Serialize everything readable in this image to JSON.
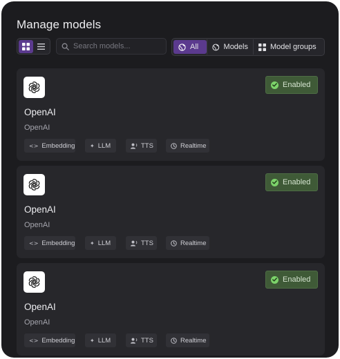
{
  "header": {
    "title": "Manage models"
  },
  "view_toggle": {
    "grid_icon": "grid-icon",
    "list_icon": "list-icon",
    "active": "grid"
  },
  "search": {
    "placeholder": "Search models...",
    "value": ""
  },
  "filters": [
    {
      "label": "All",
      "icon": "globe-icon",
      "active": true
    },
    {
      "label": "Models",
      "icon": "globe-icon",
      "active": false
    },
    {
      "label": "Model groups",
      "icon": "grid-icon",
      "active": false
    }
  ],
  "colors": {
    "background": "#1c1c1f",
    "card": "#27272b",
    "accent": "#5b3a8e",
    "enabled_badge": "#3f5a37",
    "enabled_check": "#7cd36a"
  },
  "cards": [
    {
      "name": "OpenAI",
      "provider": "OpenAI",
      "status": "Enabled",
      "tags": [
        {
          "label": "Embedding",
          "icon": "code-icon"
        },
        {
          "label": "LLM",
          "icon": "sparkle-icon"
        },
        {
          "label": "TTS",
          "icon": "voice-icon"
        },
        {
          "label": "Realtime",
          "icon": "clock-icon"
        }
      ]
    },
    {
      "name": "OpenAI",
      "provider": "OpenAI",
      "status": "Enabled",
      "tags": [
        {
          "label": "Embedding",
          "icon": "code-icon"
        },
        {
          "label": "LLM",
          "icon": "sparkle-icon"
        },
        {
          "label": "TTS",
          "icon": "voice-icon"
        },
        {
          "label": "Realtime",
          "icon": "clock-icon"
        }
      ]
    },
    {
      "name": "OpenAI",
      "provider": "OpenAI",
      "status": "Enabled",
      "tags": [
        {
          "label": "Embedding",
          "icon": "code-icon"
        },
        {
          "label": "LLM",
          "icon": "sparkle-icon"
        },
        {
          "label": "TTS",
          "icon": "voice-icon"
        },
        {
          "label": "Realtime",
          "icon": "clock-icon"
        }
      ]
    }
  ]
}
